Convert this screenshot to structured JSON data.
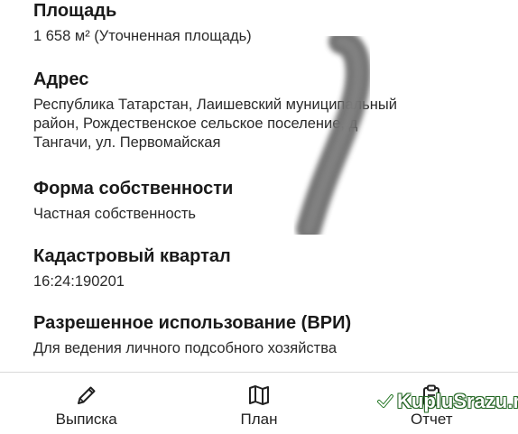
{
  "sections": [
    {
      "title": "Площадь",
      "value_lines": [
        "1 658 м² (Уточненная площадь)"
      ]
    },
    {
      "title": "Адрес",
      "value_lines": [
        "Республика Татарстан, Лаишевский муниципальный",
        "район, Рождественское сельское поселение, д",
        "Тангачи, ул. Первомайская"
      ]
    },
    {
      "title": "Форма собственности",
      "value_lines": [
        "Частная собственность"
      ]
    },
    {
      "title": "Кадастровый квартал",
      "value_lines": [
        "16:24:190201"
      ]
    },
    {
      "title": "Разрешенное использование (ВРИ)",
      "value_lines": [
        "Для ведения личного подсобного хозяйства"
      ]
    }
  ],
  "tabbar": {
    "items": [
      {
        "label": "Выписка",
        "icon": "pencil-icon"
      },
      {
        "label": "План",
        "icon": "map-icon"
      },
      {
        "label": "Отчет",
        "icon": "clipboard-icon"
      }
    ]
  },
  "watermark": {
    "text": "KupluSrazu.ru",
    "color": "#2a7a2a"
  }
}
